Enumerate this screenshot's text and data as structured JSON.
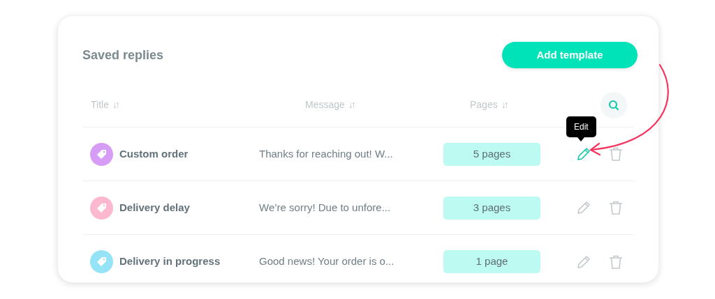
{
  "title": "Saved replies",
  "add_button": "Add template",
  "columns": [
    {
      "label": "Title",
      "sort_icon": "↓↑"
    },
    {
      "label": "Message",
      "sort_icon": "↓↑"
    },
    {
      "label": "Pages",
      "sort_icon": "↓↑"
    }
  ],
  "rows": [
    {
      "color": "#d79cf5",
      "title": "Custom order",
      "message": "Thanks for reaching out! W...",
      "pages": "5 pages",
      "edit_highlighted": true,
      "tooltip": "Edit"
    },
    {
      "color": "#fbb8cf",
      "title": "Delivery delay",
      "message": "We’re sorry! Due to unfore...",
      "pages": "3 pages",
      "edit_highlighted": false
    },
    {
      "color": "#94e3f7",
      "title": "Delivery in progress",
      "message": "Good news! Your order is o...",
      "pages": "1 page",
      "edit_highlighted": false
    }
  ]
}
